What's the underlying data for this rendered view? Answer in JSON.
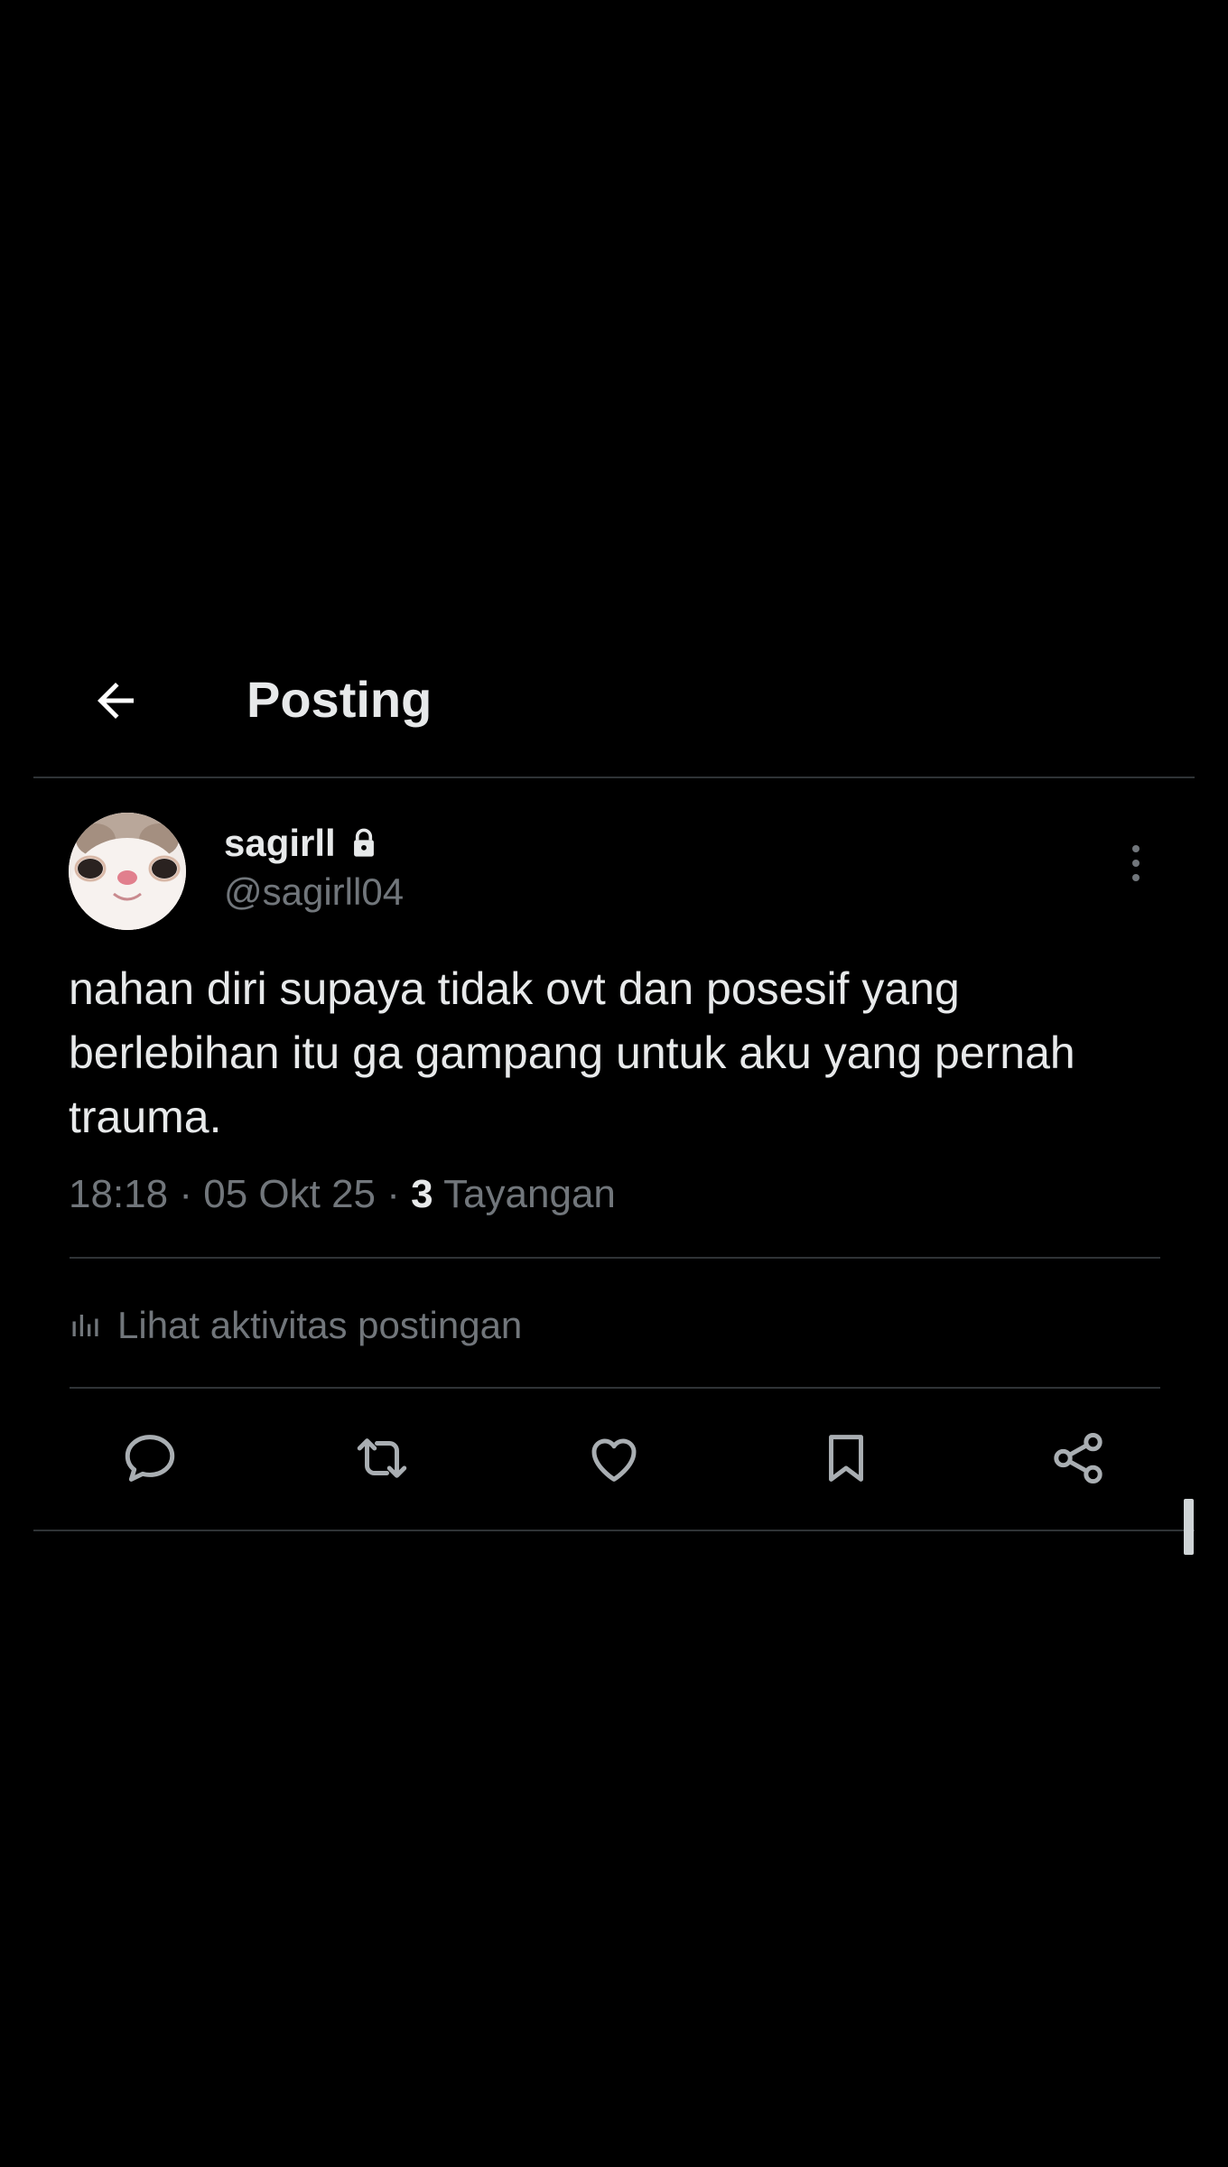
{
  "header": {
    "title": "Posting",
    "back_icon": "arrow-left-icon"
  },
  "post": {
    "author": {
      "display_name": "sagirll",
      "handle": "@sagirll04",
      "protected": true,
      "avatar": "cat-face-avatar"
    },
    "text": "nahan diri supaya tidak ovt dan posesif yang berlebihan itu ga gampang untuk aku yang pernah trauma.",
    "time": "18:18",
    "separator": "·",
    "date": "05 Okt 25",
    "views_count": "3",
    "views_label": "Tayangan"
  },
  "activity": {
    "label": "Lihat aktivitas postingan",
    "icon": "bar-chart-icon"
  },
  "actions": [
    {
      "name": "reply",
      "icon": "reply-icon"
    },
    {
      "name": "repost",
      "icon": "repost-icon"
    },
    {
      "name": "like",
      "icon": "heart-icon"
    },
    {
      "name": "bookmark",
      "icon": "bookmark-icon"
    },
    {
      "name": "share",
      "icon": "share-icon"
    }
  ],
  "colors": {
    "background": "#000000",
    "text_primary": "#e7e9ea",
    "text_secondary": "#71767b",
    "divider": "#2f3336"
  }
}
